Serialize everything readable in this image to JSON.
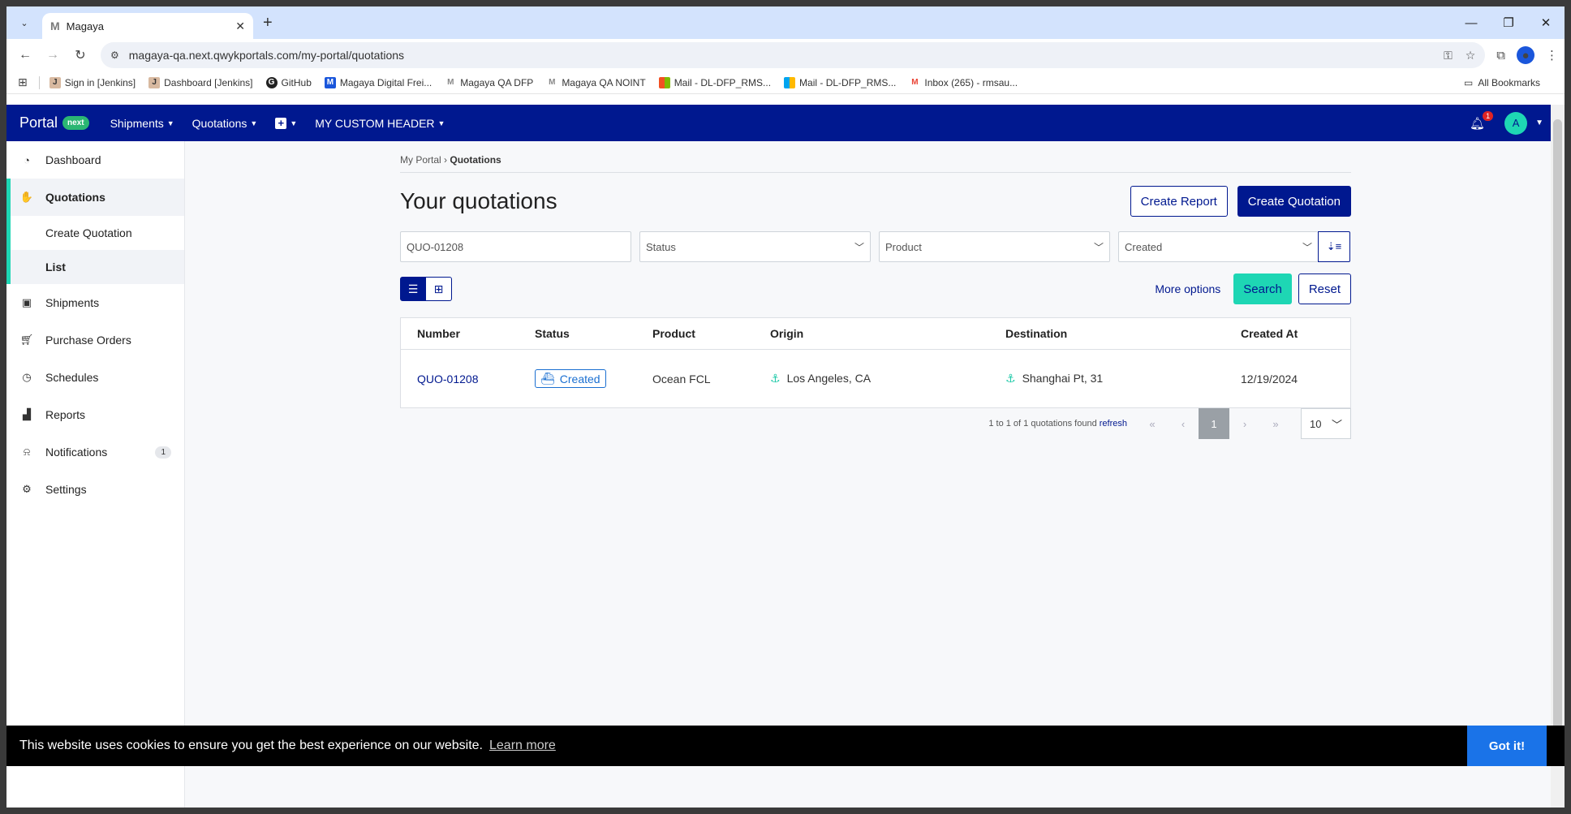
{
  "browser": {
    "tab_title": "Magaya",
    "tab_favicon": "M",
    "url": "magaya-qa.next.qwykportals.com/my-portal/quotations",
    "bookmarks": [
      {
        "label": "Sign in [Jenkins]",
        "icon": "jenkins-icon"
      },
      {
        "label": "Dashboard [Jenkins]",
        "icon": "jenkins-icon"
      },
      {
        "label": "GitHub",
        "icon": "github-icon"
      },
      {
        "label": "Magaya Digital Frei...",
        "icon": "magaya-icon"
      },
      {
        "label": "Magaya QA DFP",
        "icon": "magaya-icon"
      },
      {
        "label": "Magaya QA NOINT",
        "icon": "magaya-icon"
      },
      {
        "label": "Mail - DL-DFP_RMS...",
        "icon": "microsoft-icon"
      },
      {
        "label": "Mail - DL-DFP_RMS...",
        "icon": "microsoft-icon"
      },
      {
        "label": "Inbox (265) - rmsau...",
        "icon": "gmail-icon"
      }
    ],
    "all_bookmarks": "All Bookmarks"
  },
  "topnav": {
    "brand": "Portal",
    "brand_pill": "next",
    "items": [
      "Shipments",
      "Quotations",
      "MY CUSTOM HEADER"
    ],
    "notification_count": "1",
    "avatar_letter": "A"
  },
  "sidebar": {
    "items": [
      {
        "label": "Dashboard",
        "icon": "dashboard-icon"
      },
      {
        "label": "Quotations",
        "icon": "quotations-icon"
      },
      {
        "label": "Shipments",
        "icon": "shipments-icon"
      },
      {
        "label": "Purchase Orders",
        "icon": "cart-icon"
      },
      {
        "label": "Schedules",
        "icon": "clock-icon"
      },
      {
        "label": "Reports",
        "icon": "chart-icon"
      },
      {
        "label": "Notifications",
        "icon": "bell-icon",
        "badge": "1"
      },
      {
        "label": "Settings",
        "icon": "gear-icon"
      }
    ],
    "sub_items": [
      "Create Quotation",
      "List"
    ]
  },
  "main": {
    "breadcrumb_root": "My Portal",
    "breadcrumb_sep": "›",
    "breadcrumb_current": "Quotations",
    "title": "Your quotations",
    "create_report": "Create Report",
    "create_quotation": "Create Quotation",
    "filters": {
      "search_value": "QUO-01208",
      "status_placeholder": "Status",
      "product_placeholder": "Product",
      "sort_value": "Created"
    },
    "more_options": "More options",
    "search": "Search",
    "reset": "Reset",
    "table": {
      "headers": [
        "Number",
        "Status",
        "Product",
        "Origin",
        "Destination",
        "Created At"
      ],
      "rows": [
        {
          "number": "QUO-01208",
          "status": "Created",
          "product": "Ocean FCL",
          "origin": "Los Angeles, CA",
          "destination": "Shanghai Pt, 31",
          "created_at": "12/19/2024"
        }
      ]
    },
    "pager": {
      "info": "1 to 1 of 1 quotations found",
      "refresh": "refresh",
      "current_page": "1",
      "page_size": "10"
    }
  },
  "cookie": {
    "message": "This website uses cookies to ensure you get the best experience on our website.",
    "learn_more": "Learn more",
    "accept": "Got it!"
  },
  "colors": {
    "brand_navy": "#00188f",
    "accent_teal": "#1ed6b4",
    "status_blue": "#1a6fd1"
  }
}
